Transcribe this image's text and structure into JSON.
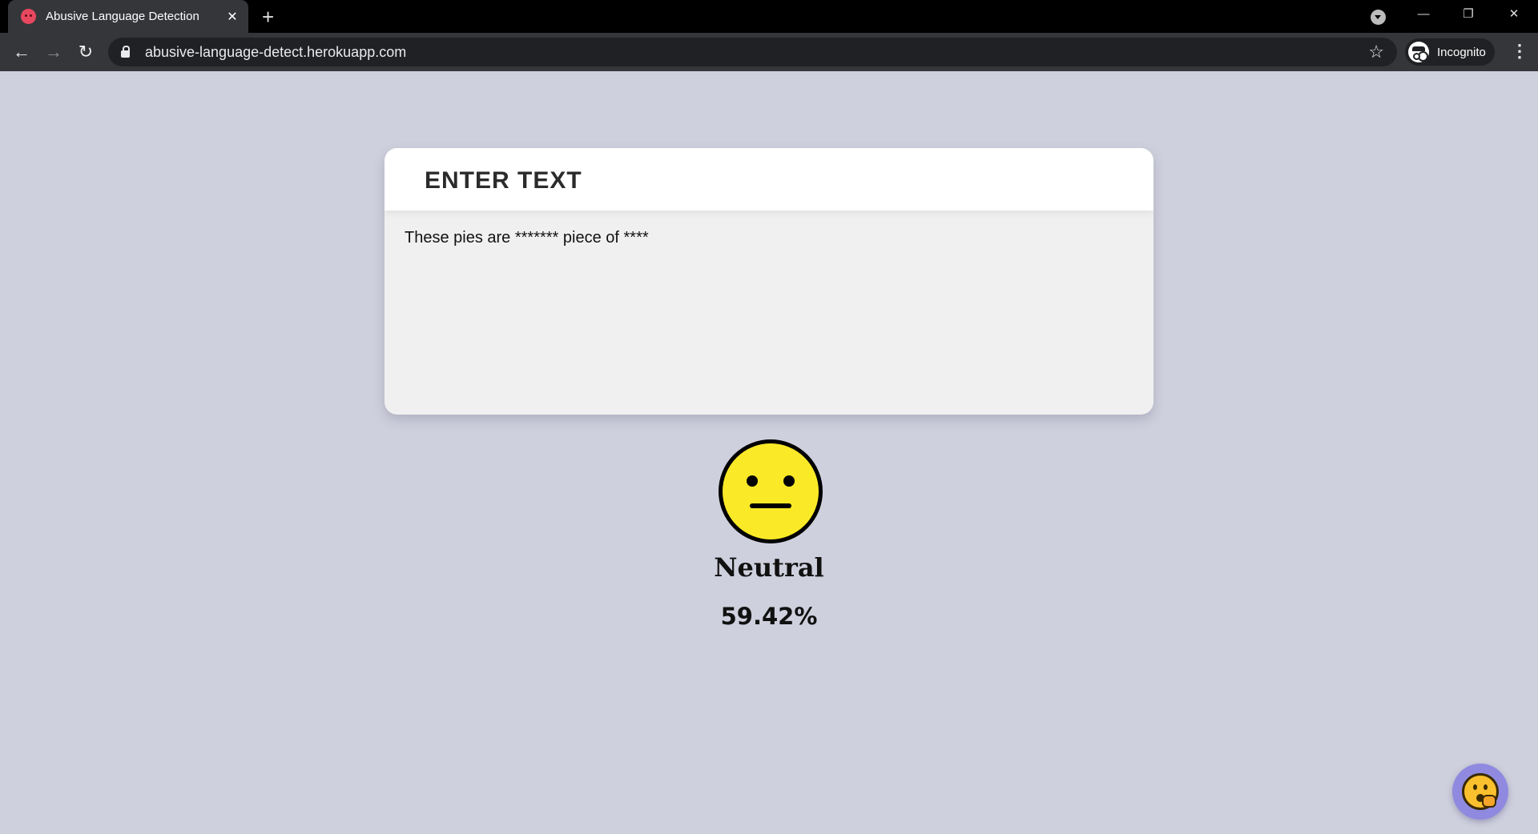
{
  "browser": {
    "tab_title": "Abusive Language Detection",
    "url": "abusive-language-detect.herokuapp.com",
    "profile_label": "Incognito"
  },
  "page": {
    "card_title": "ENTER TEXT",
    "input_text": "These pies are ******* piece of ****",
    "result_emoji": "neutral-face-icon",
    "result_label": "Neutral",
    "result_score": "59.42%"
  },
  "colors": {
    "page_background": "#cfd0dd",
    "emoji_yellow": "#fae927",
    "fab_background": "#8f8ae0"
  }
}
